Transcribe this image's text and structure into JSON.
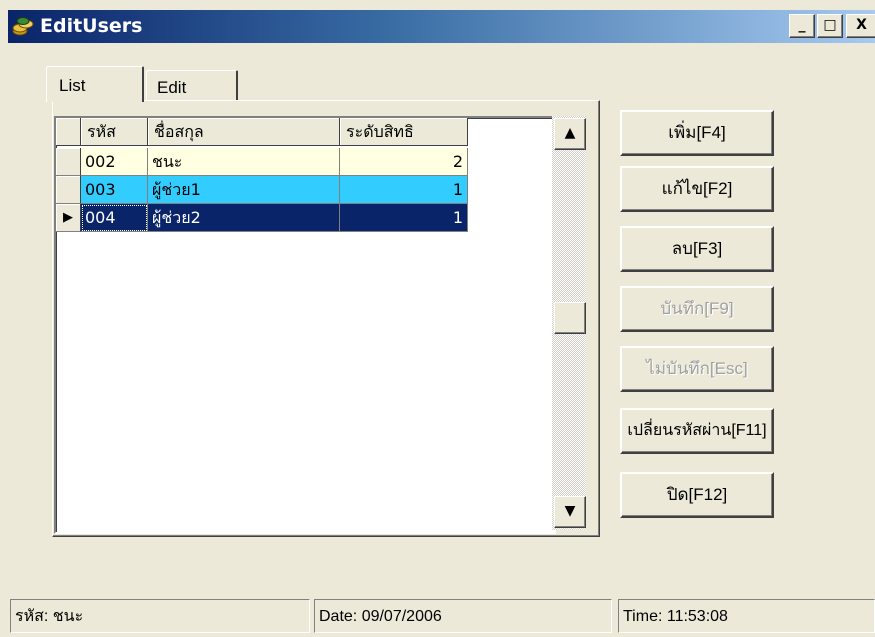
{
  "window": {
    "title": "EditUsers",
    "minimize_label": "_",
    "maximize_label": "□",
    "close_label": "X"
  },
  "tabs": [
    {
      "label": "List",
      "active": true
    },
    {
      "label": "Edit",
      "active": false
    }
  ],
  "grid": {
    "columns": [
      "รหัส",
      "ชื่อสกุล",
      "ระดับสิทธิ"
    ],
    "rows": [
      {
        "code": "002",
        "name": "ชนะ",
        "level": "2",
        "state": "normal"
      },
      {
        "code": "003",
        "name": "ผู้ช่วย1",
        "level": "1",
        "state": "selected"
      },
      {
        "code": "004",
        "name": "ผู้ช่วย2",
        "level": "1",
        "state": "current"
      }
    ],
    "current_row_marker": "▶"
  },
  "buttons": {
    "add": {
      "label": "เพิ่ม[F4]",
      "enabled": true
    },
    "edit": {
      "label": "แก้ไข[F2]",
      "enabled": true
    },
    "delete": {
      "label": "ลบ[F3]",
      "enabled": true
    },
    "save": {
      "label": "บันทึก[F9]",
      "enabled": false
    },
    "cancel": {
      "label": "ไม่บันทึก[Esc]",
      "enabled": false
    },
    "change_password": {
      "label": "เปลี่ยนรหัสผ่าน[F11]",
      "enabled": true
    },
    "close": {
      "label": "ปิด[F12]",
      "enabled": true
    }
  },
  "scrollbar": {
    "up_arrow": "▲",
    "down_arrow": "▼"
  },
  "status": {
    "user": "รหัส: ชนะ",
    "date": "Date: 09/07/2006",
    "time": "Time: 11:53:08"
  },
  "colors": {
    "titlebar_start": "#0a246a",
    "titlebar_end": "#a6caf0",
    "row_normal": "#ffffe1",
    "row_selected": "#33ccff",
    "row_current": "#0a246a"
  },
  "icons": {
    "app": "coins-icon"
  }
}
